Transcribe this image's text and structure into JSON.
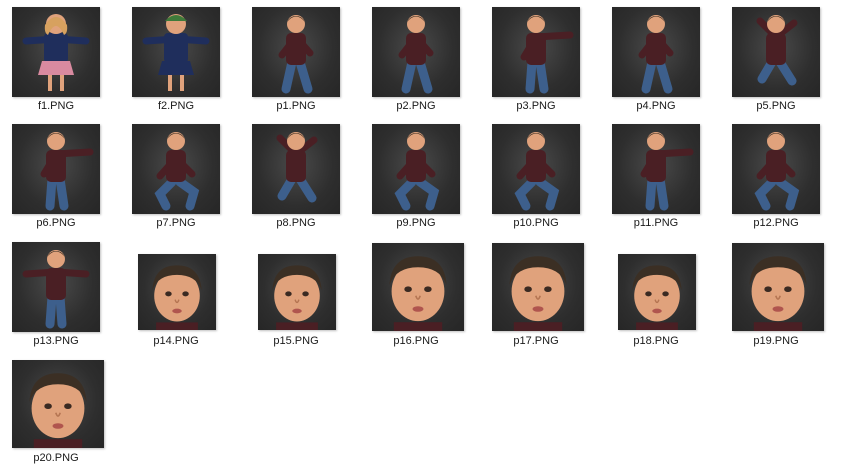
{
  "files": [
    {
      "name": "f1.PNG",
      "icon": "girl-character-thumbnail"
    },
    {
      "name": "f2.PNG",
      "icon": "girl-character-thumbnail"
    },
    {
      "name": "p1.PNG",
      "icon": "boy-character-thumbnail"
    },
    {
      "name": "p2.PNG",
      "icon": "boy-character-thumbnail"
    },
    {
      "name": "p3.PNG",
      "icon": "boy-character-thumbnail"
    },
    {
      "name": "p4.PNG",
      "icon": "boy-character-thumbnail"
    },
    {
      "name": "p5.PNG",
      "icon": "boy-character-thumbnail"
    },
    {
      "name": "p6.PNG",
      "icon": "boy-character-thumbnail"
    },
    {
      "name": "p7.PNG",
      "icon": "boy-character-thumbnail"
    },
    {
      "name": "p8.PNG",
      "icon": "boy-character-thumbnail"
    },
    {
      "name": "p9.PNG",
      "icon": "boy-character-thumbnail"
    },
    {
      "name": "p10.PNG",
      "icon": "boy-character-thumbnail"
    },
    {
      "name": "p11.PNG",
      "icon": "boy-character-thumbnail"
    },
    {
      "name": "p12.PNG",
      "icon": "boy-character-thumbnail"
    },
    {
      "name": "p13.PNG",
      "icon": "boy-character-thumbnail"
    },
    {
      "name": "p14.PNG",
      "icon": "boy-face-thumbnail"
    },
    {
      "name": "p15.PNG",
      "icon": "boy-face-thumbnail"
    },
    {
      "name": "p16.PNG",
      "icon": "boy-face-thumbnail"
    },
    {
      "name": "p17.PNG",
      "icon": "boy-face-thumbnail"
    },
    {
      "name": "p18.PNG",
      "icon": "boy-face-thumbnail"
    },
    {
      "name": "p19.PNG",
      "icon": "boy-face-thumbnail"
    },
    {
      "name": "p20.PNG",
      "icon": "boy-face-thumbnail"
    }
  ],
  "colors": {
    "thumbnail_background": "#333333",
    "shirt": "#4a1f24",
    "jeans": "#3d5f8c",
    "skin": "#e0a27c",
    "hair": "#3b2f24",
    "girl_jacket": "#1f2e5c",
    "girl_skirt": "#d98aa0",
    "label_text": "#1a1a1a"
  }
}
